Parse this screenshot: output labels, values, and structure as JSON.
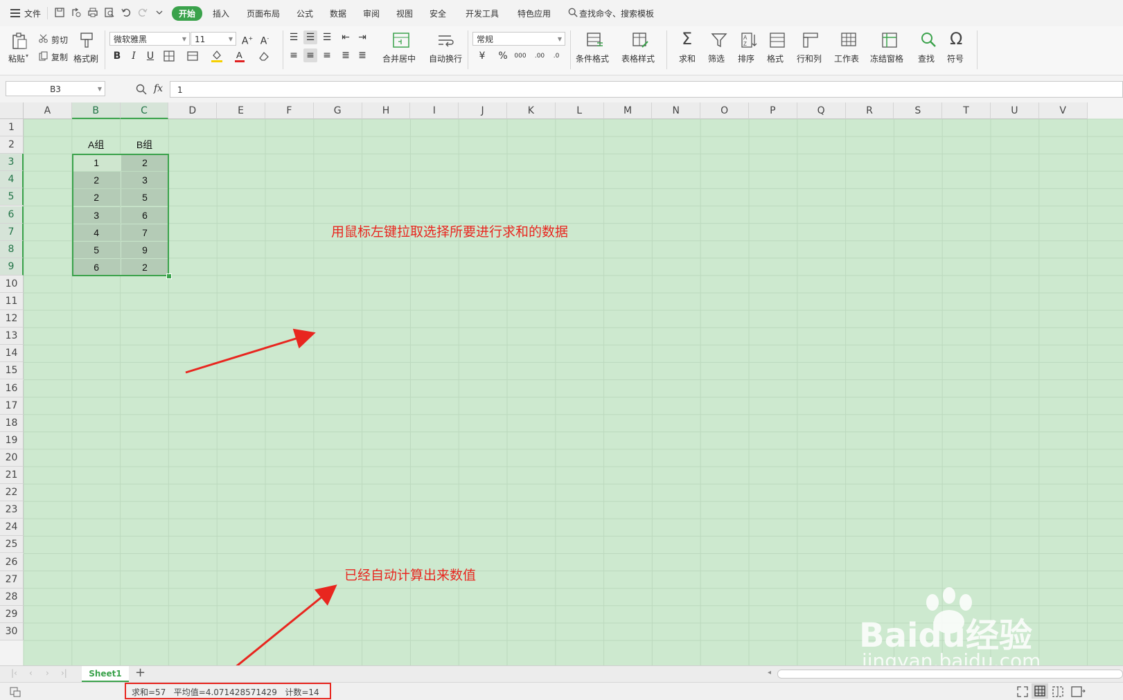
{
  "menu": {
    "file": "文件",
    "tabs": [
      "开始",
      "插入",
      "页面布局",
      "公式",
      "数据",
      "审阅",
      "视图",
      "安全",
      "开发工具",
      "特色应用"
    ],
    "search": "查找命令、搜索模板"
  },
  "ribbon": {
    "paste": "粘贴",
    "cut": "剪切",
    "copy": "复制",
    "format_painter": "格式刷",
    "font_name": "微软雅黑",
    "font_size": "11",
    "merge_center": "合并居中",
    "wrap_text": "自动换行",
    "number_format": "常规",
    "conditional_format": "条件格式",
    "table_style": "表格样式",
    "sum": "求和",
    "filter": "筛选",
    "sort": "排序",
    "format": "格式",
    "row_col": "行和列",
    "worksheet": "工作表",
    "freeze": "冻结窗格",
    "find": "查找",
    "symbol": "符号"
  },
  "formula_bar": {
    "name_box": "B3",
    "fx": "fx",
    "value": "1"
  },
  "grid": {
    "columns": [
      "A",
      "B",
      "C",
      "D",
      "E",
      "F",
      "G",
      "H",
      "I",
      "J",
      "K",
      "L",
      "M",
      "N",
      "O",
      "P",
      "Q",
      "R",
      "S",
      "T",
      "U",
      "V"
    ],
    "rows": [
      "1",
      "2",
      "3",
      "4",
      "5",
      "6",
      "7",
      "8",
      "9",
      "10",
      "11",
      "12",
      "13",
      "14",
      "15",
      "16",
      "17",
      "18",
      "19",
      "20",
      "21",
      "22",
      "23",
      "24",
      "25",
      "26",
      "27",
      "28",
      "29",
      "30"
    ],
    "headers": [
      "A组",
      "B组"
    ],
    "data": [
      [
        "1",
        "2"
      ],
      [
        "2",
        "3"
      ],
      [
        "2",
        "5"
      ],
      [
        "3",
        "6"
      ],
      [
        "4",
        "7"
      ],
      [
        "5",
        "9"
      ],
      [
        "6",
        "2"
      ]
    ]
  },
  "annotations": {
    "select_hint": "用鼠标左键拉取选择所要进行求和的数据",
    "result_hint": "已经自动计算出来数值"
  },
  "sheet_tabs": {
    "active": "Sheet1",
    "add": "+"
  },
  "status_bar": {
    "summary": "求和=57   平均值=4.071428571429   计数=14"
  },
  "watermark": {
    "brand": "Baidu经验",
    "url": "jingyan.baidu.com"
  },
  "colors": {
    "grid_bg": "#cde9cf",
    "accent": "#3aa24b",
    "annotation": "#e8261f"
  }
}
